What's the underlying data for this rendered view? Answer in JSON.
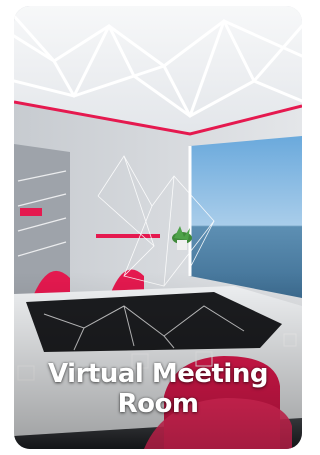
{
  "card": {
    "title_line1": "Virtual Meeting",
    "title_line2": "Room",
    "image_icon": "meeting-room-scene"
  },
  "colors": {
    "accent": "#e5194f",
    "ceiling": "#f2f3f5",
    "wall": "#d9dce0",
    "sky": "#7fb6e3",
    "floor": "#2d2f33"
  }
}
